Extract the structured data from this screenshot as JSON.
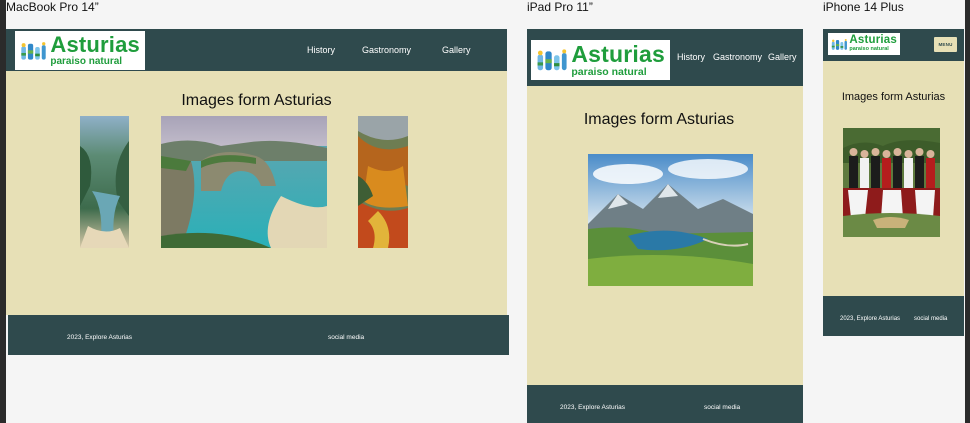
{
  "frames": {
    "macbook": {
      "label": "MacBook Pro 14”"
    },
    "ipad": {
      "label": "iPad Pro 11”"
    },
    "iphone": {
      "label": "iPhone 14 Plus"
    }
  },
  "site": {
    "logo_title": "Asturias",
    "logo_subtitle": "paraiso natural",
    "nav": [
      "History",
      "Gastronomy",
      "Gallery"
    ],
    "heading": "Images form Asturias",
    "menu_label": "MENU",
    "footer_copyright": "2023, Explore Asturias",
    "footer_social": "social media"
  },
  "colors": {
    "header_bg": "#2f4a4d",
    "body_bg": "#e7e0b6",
    "logo_green": "#1f9d3c",
    "canvas_bg": "#f5f5f5"
  },
  "images": {
    "macbook_gallery": [
      "coastal-cove-photo",
      "sea-arch-beach-photo",
      "autumn-forest-photo"
    ],
    "ipad_gallery": [
      "mountain-lake-photo"
    ],
    "iphone_gallery": [
      "folk-dancers-group-photo"
    ]
  }
}
